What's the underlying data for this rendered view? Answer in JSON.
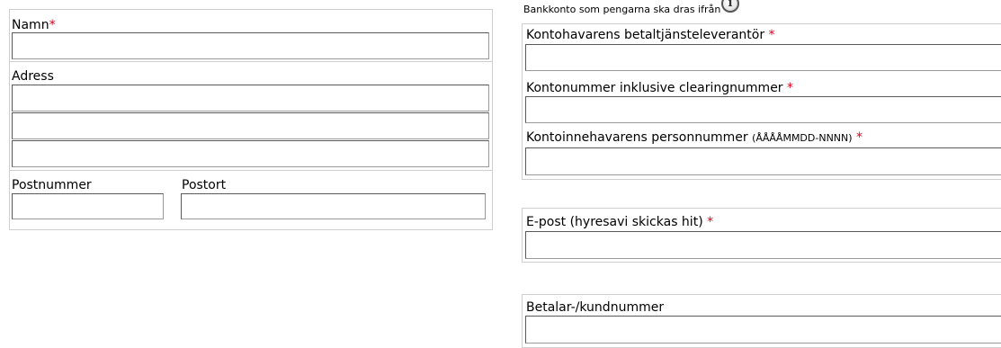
{
  "left_form": {
    "name": {
      "label": "Namn",
      "required_mark": "*",
      "value": ""
    },
    "address": {
      "label": "Adress",
      "line1": "",
      "line2": "",
      "line3": ""
    },
    "postal_code": {
      "label": "Postnummer",
      "value": ""
    },
    "city": {
      "label": "Postort",
      "value": ""
    }
  },
  "right_form": {
    "bank_heading": "Bankkonto som pengarna ska dras ifrån",
    "info_icon": "info-icon",
    "provider": {
      "label": "Kontohavarens betaltjänsteleverantör",
      "required_mark": "*",
      "value": ""
    },
    "account_number": {
      "label": "Kontonummer inklusive clearingnummer",
      "required_mark": "*",
      "value": ""
    },
    "personal_number": {
      "label": "Kontoinnehavarens personnummer",
      "format_hint": "(ÅÅÅÅMMDD-NNNN)",
      "required_mark": "*",
      "value": ""
    },
    "email": {
      "label": "E-post (hyresavi skickas hit)",
      "required_mark": "*",
      "value": ""
    },
    "customer_number": {
      "label": "Betalar-/kundnummer",
      "value": ""
    }
  },
  "colors": {
    "required": "#e0001b",
    "panel_border": "#cfcfcf",
    "input_border": "#5a5a5a"
  }
}
